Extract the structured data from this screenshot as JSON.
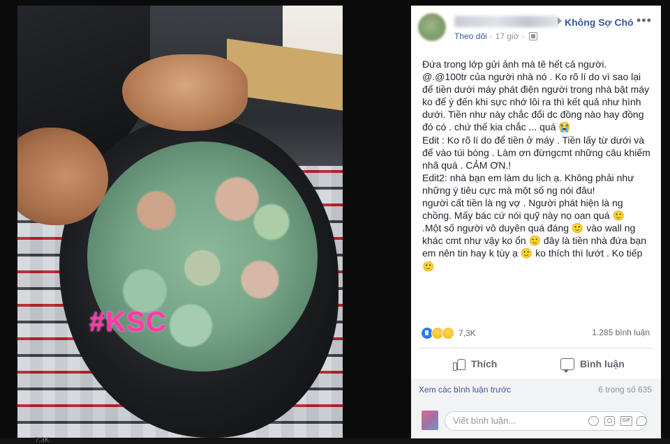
{
  "photo": {
    "watermark": "#KSC",
    "description_icon": "photo"
  },
  "post": {
    "page_name": "Không Sợ Chó",
    "follow_label": "Theo dõi",
    "separator": "·",
    "time": "17 giờ",
    "more_icon": "ellipsis-icon",
    "privacy_icon": "globe-icon",
    "text_lines": [
      "Đứa trong lớp gửi ảnh mà tê hết cả người.",
      "@.@100tr của người nhà nó . Ko rõ lí do vì sao lại",
      "để tiền dưới máy phát điện người trong nhà bật máy",
      "ko để ý đến khi sực nhớ lôi ra thì kết quả như hình",
      "dưới. Tiền như này chắc đổi dc đồng nào hay đồng",
      "đó có . chứ thế kia chắc ... quá 😭",
      "Edit : Ko rõ lí do để tiền ở máy . Tiền lấy từ dưới và",
      "để vào túi bóng . Làm ơn đừngcmt những câu khiếm",
      "nhã quá . CẢM ƠN.!",
      "Edit2: nhà bạn em làm du lịch ạ. Không phải như",
      "những ý tiêu cực mà một số ng nói đâu!",
      "người cất tiền là ng vợ . Người phát hiện là ng",
      "chồng. Mấy bác cứ nói quỹ này nọ oan quá 🙂",
      ".Một số người vô duyên quá đáng 🙂 vào wall ng",
      "khác cmt như vậy ko ổn 🙂 đây là tiền nhà đứa bạn",
      "em nên tin hay k tùy ạ 🙂 ko thích thì lướt . Ko tiếp",
      "🙂"
    ]
  },
  "stats": {
    "reaction_icons": [
      "like-icon",
      "sad-icon",
      "haha-icon"
    ],
    "reaction_count": "7,3K",
    "comment_count": "1.285 bình luận"
  },
  "actions": {
    "like_label": "Thích",
    "comment_label": "Bình luận"
  },
  "comments": {
    "view_previous": "Xem các bình luận trước",
    "page_count": "6 trong số 635",
    "input_placeholder": "Viết bình luận...",
    "input_icons": [
      "emoji-icon",
      "camera-icon",
      "gif-icon",
      "sticker-icon"
    ],
    "gif_text": "GIF"
  },
  "bottom_strip": {
    "text": "7,3K"
  },
  "colors": {
    "link": "#365899",
    "text": "#1d2129",
    "muted": "#90949c",
    "watermark": "#ff3aa8",
    "like_blue": "#2a7cf2"
  }
}
